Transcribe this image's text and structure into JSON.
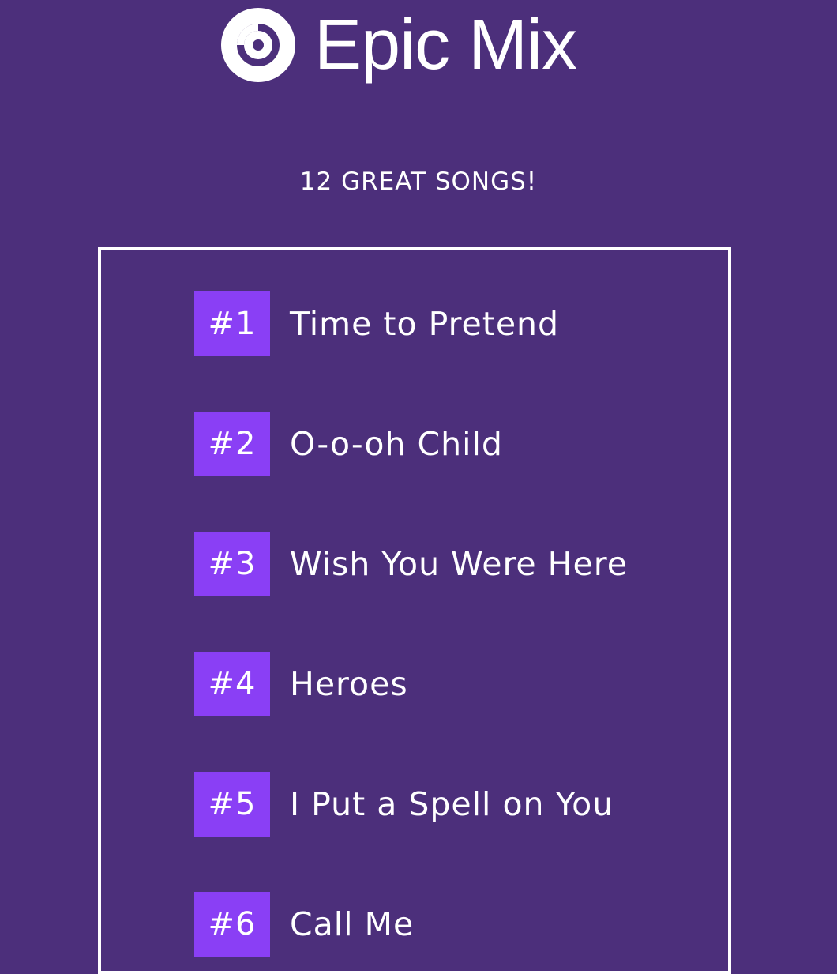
{
  "header": {
    "logo_icon": "disc-icon",
    "title": "Epic Mix"
  },
  "subtitle": "12 GREAT SONGS!",
  "colors": {
    "background": "#4c2f7b",
    "badge": "#8a3ff5",
    "text": "#ffffff",
    "border": "#ffffff"
  },
  "songs": [
    {
      "rank": "#1",
      "title": "Time to Pretend"
    },
    {
      "rank": "#2",
      "title": "O-o-oh Child"
    },
    {
      "rank": "#3",
      "title": "Wish You Were Here"
    },
    {
      "rank": "#4",
      "title": "Heroes"
    },
    {
      "rank": "#5",
      "title": "I Put a Spell on You"
    },
    {
      "rank": "#6",
      "title": "Call Me"
    }
  ]
}
